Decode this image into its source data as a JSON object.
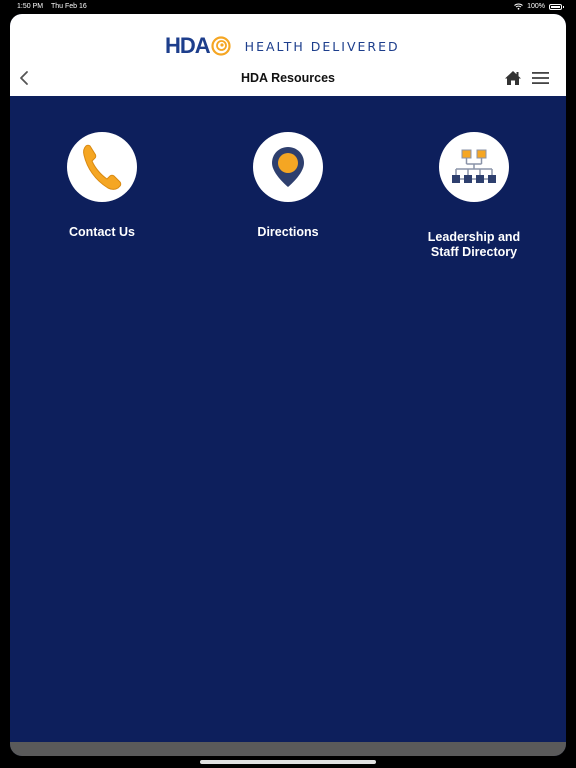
{
  "status_bar": {
    "time": "1:50 PM",
    "date": "Thu Feb 16",
    "battery": "100%"
  },
  "header": {
    "logo_text": "HDA",
    "tagline": "HEALTH DELIVERED",
    "title": "HDA Resources",
    "icons": {
      "back": "chevron-left-icon",
      "home": "home-icon",
      "menu": "hamburger-menu-icon"
    }
  },
  "tiles": [
    {
      "label": "Contact Us",
      "icon": "phone-icon"
    },
    {
      "label": "Directions",
      "icon": "map-pin-icon"
    },
    {
      "label": "Leadership and Staff Directory",
      "icon": "org-chart-icon"
    }
  ],
  "colors": {
    "background": "#0d1f5c",
    "brand_blue": "#1d3e8c",
    "accent_orange": "#f5a623",
    "header_bg": "#ffffff"
  }
}
